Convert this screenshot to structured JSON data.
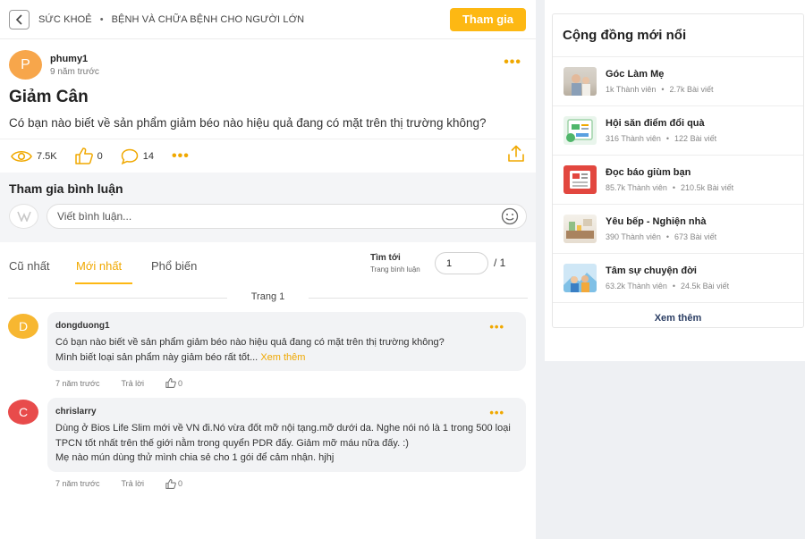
{
  "header": {
    "breadcrumb": [
      "SỨC KHOẺ",
      "BỆNH VÀ CHỮA BỆNH CHO NGƯỜI LỚN"
    ],
    "breadcrumb_sep": "•",
    "join_label": "Tham gia"
  },
  "post": {
    "avatar_letter": "P",
    "author": "phumy1",
    "time": "9 năm trước",
    "title": "Giảm Cân",
    "body": "Có bạn nào biết về sản phẩm giảm béo nào hiệu quả đang có mặt trên thị trường không?",
    "views": "7.5K",
    "likes": "0",
    "comments": "14",
    "more": "•••"
  },
  "comment_box": {
    "title": "Tham gia bình luận",
    "placeholder": "Viết bình luận..."
  },
  "tabs": [
    {
      "label": "Cũ nhất",
      "active": false
    },
    {
      "label": "Mới nhất",
      "active": true
    },
    {
      "label": "Phổ biến",
      "active": false
    }
  ],
  "pagination": {
    "goto_label": "Tìm tới",
    "goto_sub": "Trang bình luận",
    "current": "1",
    "total": "/ 1",
    "page_label": "Trang 1"
  },
  "comments": [
    {
      "avatar_letter": "D",
      "avatar_color": "#f7b731",
      "author": "dongduong1",
      "text_1": "Có bạn nào biết về sản phẩm giảm béo nào hiệu quả đang có mặt trên thị trường không?",
      "text_2": "Mình biết loại sản phẩm này giảm béo rất tốt...",
      "see_more": "Xem thêm",
      "time": "7 năm trước",
      "reply": "Trả lời",
      "likes": "0"
    },
    {
      "avatar_letter": "C",
      "avatar_color": "#e84b4b",
      "author": "chrislarry",
      "text_1": "Dùng ở Bios Life Slim mới về VN đi.Nó vừa đốt mỡ nội tạng.mỡ dưới da. Nghe nói nó là 1 trong 500 loại TPCN tốt nhất trên thế giới nằm trong quyển PDR đấy. Giảm mỡ máu nữa đấy. :)",
      "text_2": "Mẹ nào mún dùng thử mình chia sẻ cho 1 gói để cảm nhận. hjhj",
      "time": "7 năm trước",
      "reply": "Trả lời",
      "likes": "0"
    }
  ],
  "sidebar": {
    "title": "Cộng đồng mới nổi",
    "communities": [
      {
        "name": "Góc Làm Mẹ",
        "members": "1k Thành viên",
        "posts": "2.7k Bài viết"
      },
      {
        "name": "Hội săn điểm đổi quà",
        "members": "316 Thành viên",
        "posts": "122 Bài viết"
      },
      {
        "name": "Đọc báo giùm bạn",
        "members": "85.7k Thành viên",
        "posts": "210.5k Bài viết"
      },
      {
        "name": "Yêu bếp - Nghiện nhà",
        "members": "390 Thành viên",
        "posts": "673 Bài viết"
      },
      {
        "name": "Tâm sự chuyện đời",
        "members": "63.2k Thành viên",
        "posts": "24.5k Bài viết"
      }
    ],
    "see_more": "Xem thêm"
  },
  "colors": {
    "accent": "#fdb813",
    "accent_text": "#f0a800",
    "link_dark": "#2a3d63"
  }
}
